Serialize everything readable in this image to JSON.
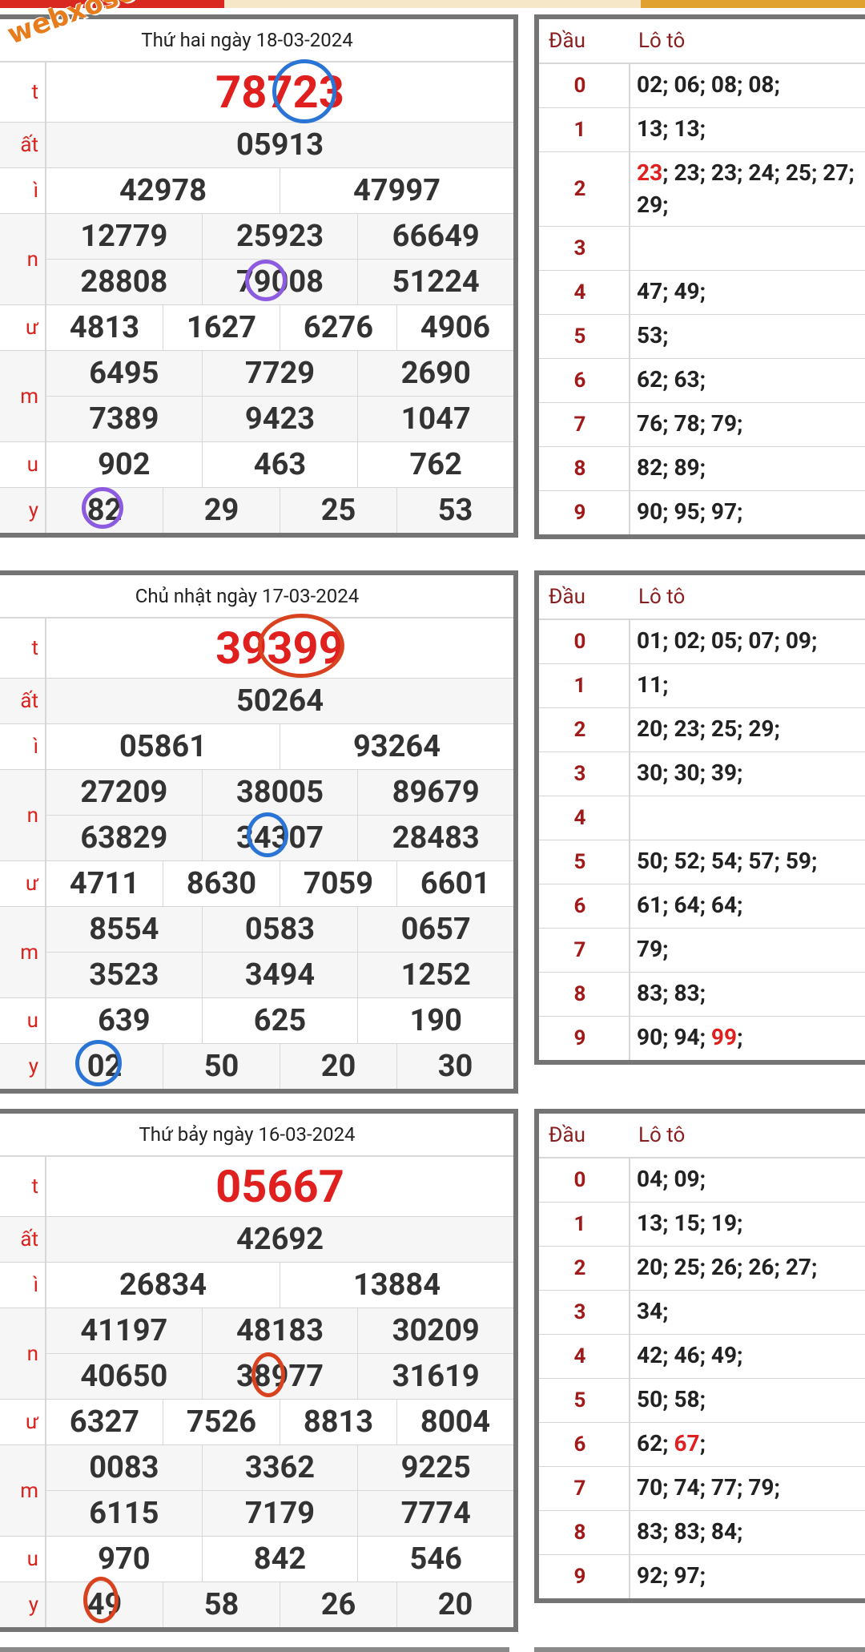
{
  "watermark": "webxoso.net",
  "days": [
    {
      "title": "Thứ hai ngày 18-03-2024",
      "labels": {
        "db": "t",
        "g1": "ất",
        "g2": "ì",
        "g3": "n",
        "g4": "ư",
        "g5": "m",
        "g6": "u",
        "g7": "y"
      },
      "special": "78723",
      "g1": [
        "05913"
      ],
      "g2": [
        "42978",
        "47997"
      ],
      "g3": [
        [
          "12779",
          "25923",
          "66649"
        ],
        [
          "28808",
          "79008",
          "51224"
        ]
      ],
      "g4": [
        "4813",
        "1627",
        "6276",
        "4906"
      ],
      "g5": [
        [
          "6495",
          "7729",
          "2690"
        ],
        [
          "7389",
          "9423",
          "1047"
        ]
      ],
      "g6": [
        "902",
        "463",
        "762"
      ],
      "g7": [
        "82",
        "29",
        "25",
        "53"
      ],
      "loto_header": {
        "dau": "Đầu",
        "loto": "Lô tô"
      },
      "loto": [
        {
          "k": "0",
          "v": "02; 06; 08; 08;"
        },
        {
          "k": "1",
          "v": "13; 13;"
        },
        {
          "k": "2",
          "v_red": "23",
          "v": "; 23; 23; 24; 25; 27; 29;"
        },
        {
          "k": "3",
          "v": ""
        },
        {
          "k": "4",
          "v": "47; 49;"
        },
        {
          "k": "5",
          "v": "53;"
        },
        {
          "k": "6",
          "v": "62; 63;"
        },
        {
          "k": "7",
          "v": "76; 78; 79;"
        },
        {
          "k": "8",
          "v": "82; 89;"
        },
        {
          "k": "9",
          "v": "90; 95; 97;"
        }
      ]
    },
    {
      "title": "Chủ nhật ngày 17-03-2024",
      "labels": {
        "db": "t",
        "g1": "ất",
        "g2": "ì",
        "g3": "n",
        "g4": "ư",
        "g5": "m",
        "g6": "u",
        "g7": "y"
      },
      "special": "39399",
      "g1": [
        "50264"
      ],
      "g2": [
        "05861",
        "93264"
      ],
      "g3": [
        [
          "27209",
          "38005",
          "89679"
        ],
        [
          "63829",
          "34307",
          "28483"
        ]
      ],
      "g4": [
        "4711",
        "8630",
        "7059",
        "6601"
      ],
      "g5": [
        [
          "8554",
          "0583",
          "0657"
        ],
        [
          "3523",
          "3494",
          "1252"
        ]
      ],
      "g6": [
        "639",
        "625",
        "190"
      ],
      "g7": [
        "02",
        "50",
        "20",
        "30"
      ],
      "loto_header": {
        "dau": "Đầu",
        "loto": "Lô tô"
      },
      "loto": [
        {
          "k": "0",
          "v": "01; 02; 05; 07; 09;"
        },
        {
          "k": "1",
          "v": "11;"
        },
        {
          "k": "2",
          "v": "20; 23; 25; 29;"
        },
        {
          "k": "3",
          "v": "30; 30; 39;"
        },
        {
          "k": "4",
          "v": ""
        },
        {
          "k": "5",
          "v": "50; 52; 54; 57; 59;"
        },
        {
          "k": "6",
          "v": "61; 64; 64;"
        },
        {
          "k": "7",
          "v": "79;"
        },
        {
          "k": "8",
          "v": "83; 83;"
        },
        {
          "k": "9",
          "v": "90; 94; ",
          "v_red_end": "99",
          ";": ";"
        }
      ]
    },
    {
      "title": "Thứ bảy ngày 16-03-2024",
      "labels": {
        "db": "t",
        "g1": "ất",
        "g2": "ì",
        "g3": "n",
        "g4": "ư",
        "g5": "m",
        "g6": "u",
        "g7": "y"
      },
      "special": "05667",
      "g1": [
        "42692"
      ],
      "g2": [
        "26834",
        "13884"
      ],
      "g3": [
        [
          "41197",
          "48183",
          "30209"
        ],
        [
          "40650",
          "38977",
          "31619"
        ]
      ],
      "g4": [
        "6327",
        "7526",
        "8813",
        "8004"
      ],
      "g5": [
        [
          "0083",
          "3362",
          "9225"
        ],
        [
          "6115",
          "7179",
          "7774"
        ]
      ],
      "g6": [
        "970",
        "842",
        "546"
      ],
      "g7": [
        "49",
        "58",
        "26",
        "20"
      ],
      "loto_header": {
        "dau": "Đầu",
        "loto": "Lô tô"
      },
      "loto": [
        {
          "k": "0",
          "v": "04; 09;"
        },
        {
          "k": "1",
          "v": "13; 15; 19;"
        },
        {
          "k": "2",
          "v": "20; 25; 26; 26; 27;"
        },
        {
          "k": "3",
          "v": "34;"
        },
        {
          "k": "4",
          "v": "42; 46; 49;"
        },
        {
          "k": "5",
          "v": "50; 58;"
        },
        {
          "k": "6",
          "v": "62; ",
          "v_red_end": "67",
          ";": ";"
        },
        {
          "k": "7",
          "v": "70; 74; 77; 79;"
        },
        {
          "k": "8",
          "v": "83; 83; 84;"
        },
        {
          "k": "9",
          "v": "92; 97;"
        }
      ]
    }
  ],
  "colors": {
    "accent_red": "#e01f1f",
    "border": "#747474",
    "circle_blue": "#2a74d6",
    "circle_purple": "#8c5be0",
    "circle_red": "#d8421f"
  }
}
